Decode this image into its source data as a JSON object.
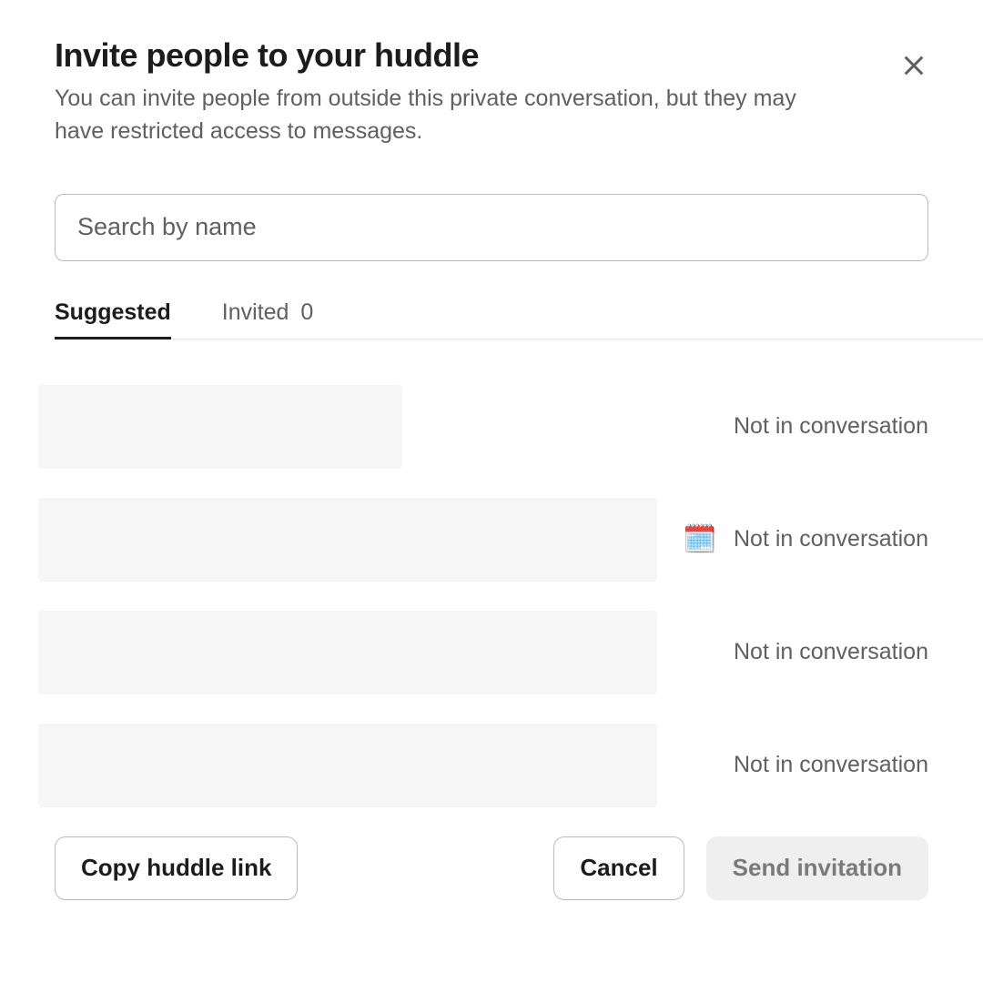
{
  "header": {
    "title": "Invite people to your huddle",
    "subtitle": "You can invite people from outside this private conversation, but they may have restricted access to messages."
  },
  "search": {
    "placeholder": "Search by name",
    "value": ""
  },
  "tabs": {
    "suggested_label": "Suggested",
    "invited_label": "Invited",
    "invited_count": "0"
  },
  "suggested": [
    {
      "status_text": "Not in conversation",
      "status_emoji": "",
      "placeholder_size": "small"
    },
    {
      "status_text": "Not in conversation",
      "status_emoji": "🗓️",
      "placeholder_size": "large"
    },
    {
      "status_text": "Not in conversation",
      "status_emoji": "",
      "placeholder_size": "large"
    },
    {
      "status_text": "Not in conversation",
      "status_emoji": "",
      "placeholder_size": "large"
    }
  ],
  "footer": {
    "copy_link_label": "Copy huddle link",
    "cancel_label": "Cancel",
    "send_label": "Send invitation"
  }
}
